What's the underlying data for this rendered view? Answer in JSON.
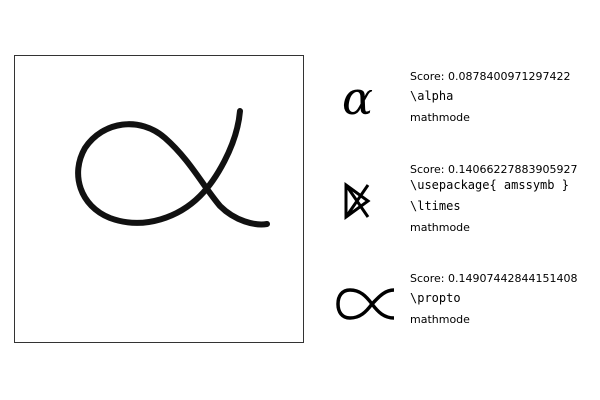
{
  "drawing": {
    "stroke_color": "#111111",
    "shape": "alpha-like handwritten stroke"
  },
  "results": [
    {
      "glyph": "alpha-symbol",
      "score": "Score: 0.0878400971297422",
      "package": "",
      "command": "\\alpha",
      "mode": "mathmode"
    },
    {
      "glyph": "ltimes-symbol",
      "score": "Score: 0.14066227883905927",
      "package": "\\usepackage{ amssymb }",
      "command": "\\ltimes",
      "mode": "mathmode"
    },
    {
      "glyph": "propto-symbol",
      "score": "Score: 0.14907442844151408",
      "package": "",
      "command": "\\propto",
      "mode": "mathmode"
    }
  ]
}
